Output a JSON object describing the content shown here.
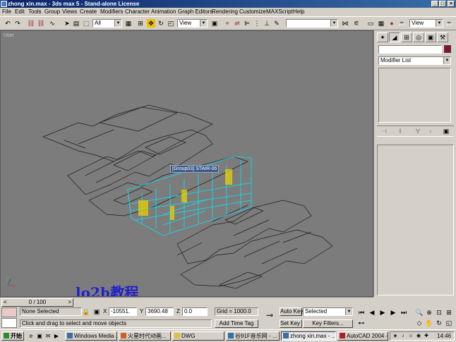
{
  "window": {
    "title": "zhong xin.max - 3ds max 5 - Stand-alone License"
  },
  "menu": [
    "File",
    "Edit",
    "Tools",
    "Group",
    "Views",
    "Create",
    "Modifiers",
    "Character",
    "Animation",
    "Graph Editors",
    "Rendering",
    "Customize",
    "MAXScript",
    "Help"
  ],
  "toolbar": {
    "selection_filter": "All",
    "ref_coord": "View",
    "named_selection": "",
    "render_type": "View"
  },
  "viewport": {
    "label": "User",
    "tooltip": "[Group03] STAIR-06",
    "watermark": "lo2h教程"
  },
  "command_panel": {
    "modifier_list": "Modifier List",
    "name_field": "",
    "object_color": "#8a1030"
  },
  "timeslider": {
    "frame": "0 / 100"
  },
  "status": {
    "selection": "None Selected",
    "prompt": "Click and drag to select and move objects",
    "x_label": "X",
    "x_value": "-10551.",
    "y_label": "Y",
    "y_value": "3690.48",
    "z_label": "Z",
    "z_value": "0.0",
    "grid": "Grid = 1000.0",
    "add_time_tag": "Add Time Tag",
    "auto_key": "Auto Key",
    "set_key": "Set Key",
    "key_mode": "Selected",
    "key_filters": "Key Filters..."
  },
  "taskbar": {
    "start": "开始",
    "tasks": [
      "Windows Media ...",
      "火星时代动画...",
      "DWG",
      "谷91F音乐网 - ...",
      "zhong xin.max - ...",
      "AutoCAD 2004 - ..."
    ],
    "clock": "14:46"
  },
  "colors": {
    "viewport_bg": "#7c7c7c",
    "selected": "#00ffff",
    "linework": "#1a1a1a",
    "watermark": "#2020c8"
  }
}
